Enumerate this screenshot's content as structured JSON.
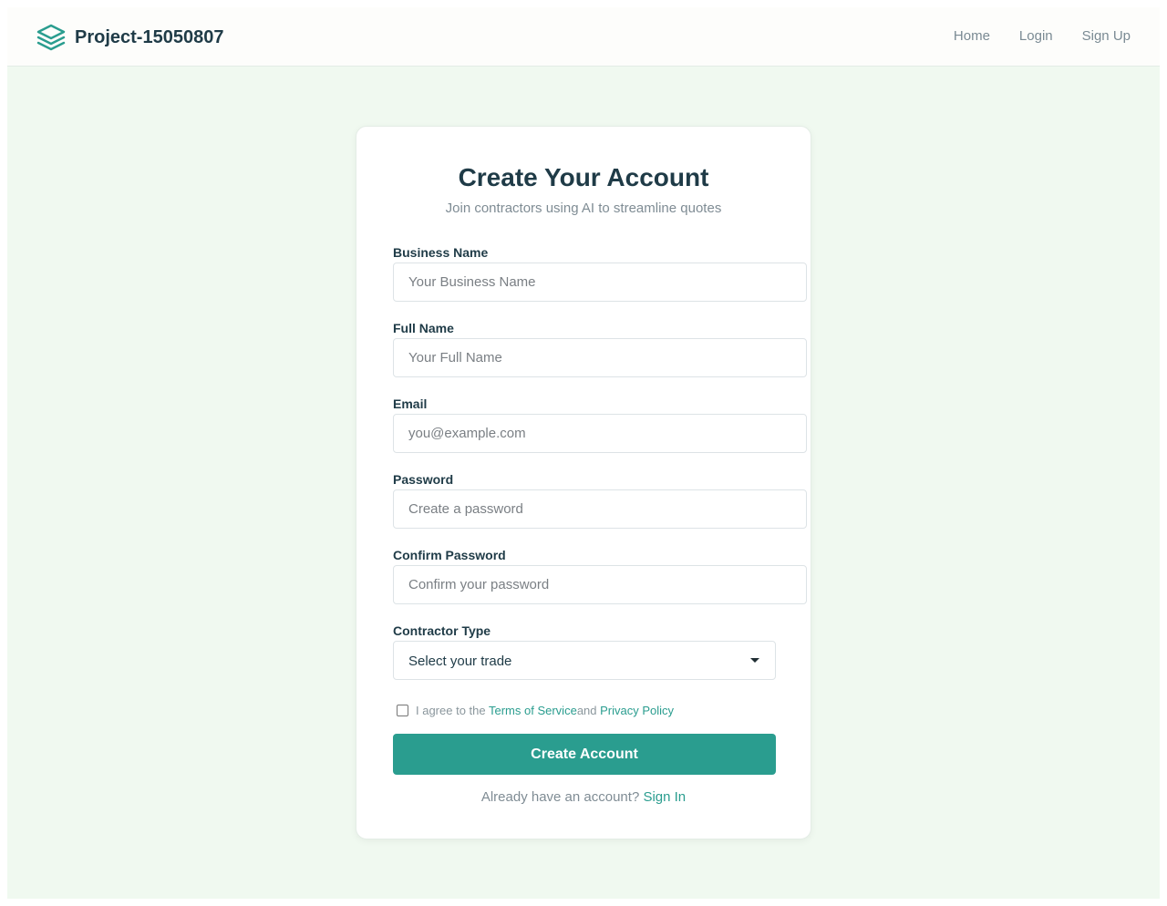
{
  "brand": {
    "name": "Project-15050807",
    "icon": "layers-icon",
    "accent_color": "#2a9d8f"
  },
  "nav": {
    "links": [
      "Home",
      "Login",
      "Sign Up"
    ]
  },
  "form": {
    "title": "Create Your Account",
    "subtitle": "Join contractors using AI to streamline quotes",
    "fields": [
      {
        "label": "Business Name",
        "placeholder": "Your Business Name",
        "value": ""
      },
      {
        "label": "Full Name",
        "placeholder": "Your Full Name",
        "value": ""
      },
      {
        "label": "Email",
        "placeholder": "you@example.com",
        "value": ""
      },
      {
        "label": "Password",
        "placeholder": "Create a password",
        "value": ""
      },
      {
        "label": "Confirm Password",
        "placeholder": "Confirm your password",
        "value": ""
      }
    ],
    "contractor_type": {
      "label": "Contractor Type",
      "selected": "Select your trade"
    },
    "terms": {
      "checked": false,
      "prefix": "I agree to the ",
      "terms_link": "Terms of Service",
      "middle": "and ",
      "privacy_link": "Privacy Policy"
    },
    "submit_label": "Create Account",
    "signin_prompt": "Already have an account?",
    "signin_link": "Sign In"
  }
}
